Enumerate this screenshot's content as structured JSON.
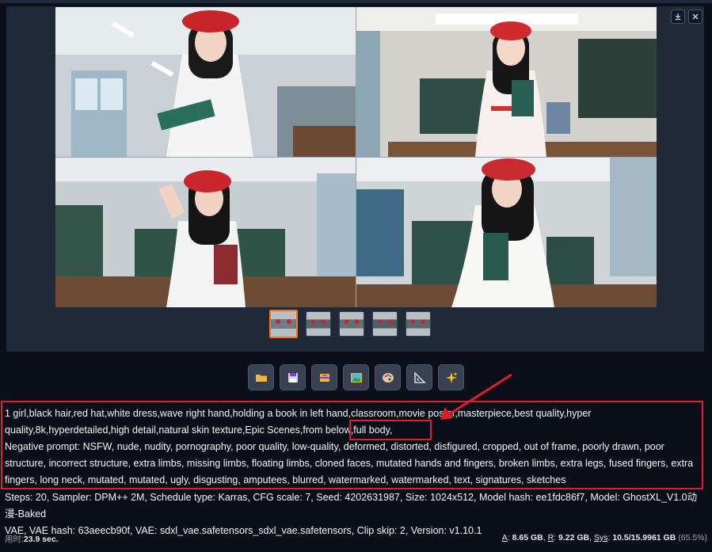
{
  "gallery": {
    "images": [
      {
        "name": "image-1"
      },
      {
        "name": "image-2"
      },
      {
        "name": "image-3"
      },
      {
        "name": "image-4"
      }
    ],
    "thumb_count": 5,
    "selected_thumb": 0,
    "download_icon": "download-icon",
    "close_icon": "close-icon"
  },
  "toolbar": {
    "buttons": [
      {
        "icon": "folder-icon",
        "emoji": "📁"
      },
      {
        "icon": "save-icon",
        "emoji": "💾"
      },
      {
        "icon": "zip-icon",
        "emoji": "🗂"
      },
      {
        "icon": "send-to-img2img-icon",
        "emoji": "🖼"
      },
      {
        "icon": "send-to-inpaint-icon",
        "emoji": "🎨"
      },
      {
        "icon": "send-to-extras-icon",
        "emoji": "📐"
      },
      {
        "icon": "sparkle-icon",
        "emoji": "✨"
      }
    ]
  },
  "info": {
    "prompt_line1": "1 girl,black hair,red hat,white dress,wave right hand,holding a book in left hand,classroom,movie poster,masterpiece,best quality,hyper",
    "prompt_line2": "quality,8k,hyperdetailed,high detail,natural skin texture,Epic Scenes,from below,full body,",
    "negative_line1": "Negative prompt: NSFW, nude, nudity, pornography, poor quality, low-quality, deformed, distorted, disfigured, cropped, out of frame, poorly drawn, poor",
    "negative_line2": "structure, incorrect structure, extra limbs, missing limbs, floating limbs, cloned faces, mutated hands and fingers, broken limbs, extra legs, fused fingers, extra",
    "negative_line3": "fingers, long neck, mutated, mutated, ugly, disgusting, amputees, blurred, watermarked, watermarked, text, signatures, sketches",
    "params_line1": "Steps: 20, Sampler: DPM++ 2M, Schedule type: Karras, CFG scale: 7, Seed: 4202631987, Size: 1024x512, Model hash: ee1fdc86f7, Model: GhostXL_V1.0动漫-Baked",
    "params_line2": "VAE, VAE hash: 63aeecb90f, VAE: sdxl_vae.safetensors_sdxl_vae.safetensors, Clip skip: 2, Version: v1.10.1"
  },
  "footer": {
    "time_label": "用时:",
    "time_value": "23.9 sec.",
    "a_label": "A",
    "a_value": "8.65 GB",
    "r_label": "R",
    "r_value": "9.22 GB",
    "sys_label": "Sys",
    "sys_value": "10.5/15.9961 GB",
    "sys_pct": "(65.5%)"
  },
  "colors": {
    "annotation": "#e11d2b",
    "selected_thumb": "#f97316",
    "background": "#0b0f19"
  }
}
